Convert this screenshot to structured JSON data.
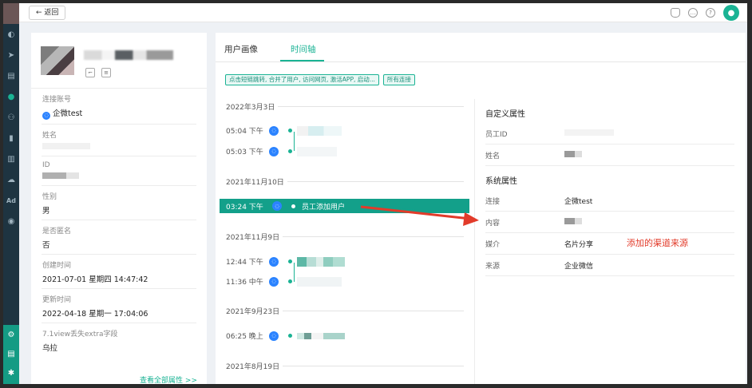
{
  "topbar": {
    "back_label": "← 返回"
  },
  "profile": {
    "fields": [
      {
        "label": "连接账号",
        "value": "企微test"
      },
      {
        "label": "姓名",
        "value": ""
      },
      {
        "label": "ID",
        "value": ""
      },
      {
        "label": "性别",
        "value": "男"
      },
      {
        "label": "是否匿名",
        "value": "否"
      },
      {
        "label": "创建时间",
        "value": "2021-07-01 星期四 14:47:42"
      },
      {
        "label": "更新时间",
        "value": "2022-04-18 星期一 17:04:06"
      },
      {
        "label": "7.1view丢失extra字段",
        "value": "乌拉"
      }
    ],
    "view_all": "查看全部属性 >>"
  },
  "tabs": [
    {
      "label": "用户画像"
    },
    {
      "label": "时间轴"
    }
  ],
  "filters": [
    "点击短链跳转, 合并了用户, 访问网页, 激活APP, 启动...",
    "所有连接"
  ],
  "timeline": {
    "dates": [
      "2022年3月3日",
      "2021年11月10日",
      "2021年11月9日",
      "2021年9月23日",
      "2021年8月19日"
    ],
    "events": [
      {
        "time": "05:04 下午"
      },
      {
        "time": "05:03 下午"
      },
      {
        "time": "03:24 下午",
        "label": "员工添加用户"
      },
      {
        "time": "12:44 下午"
      },
      {
        "time": "11:36 中午"
      },
      {
        "time": "06:25 晚上"
      }
    ]
  },
  "attributes": {
    "custom_title": "自定义属性",
    "custom": [
      {
        "key": "员工ID"
      },
      {
        "key": "姓名"
      }
    ],
    "system_title": "系统属性",
    "system": [
      {
        "key": "连接",
        "value": "企微test"
      },
      {
        "key": "内容",
        "value": ""
      },
      {
        "key": "媒介",
        "value": "名片分享"
      },
      {
        "key": "来源",
        "value": "企业微信"
      }
    ]
  },
  "annotation": "添加的渠道来源",
  "colors": {
    "accent": "#1ab394",
    "annotation": "#e23b2a",
    "rail": "#1e3441"
  }
}
